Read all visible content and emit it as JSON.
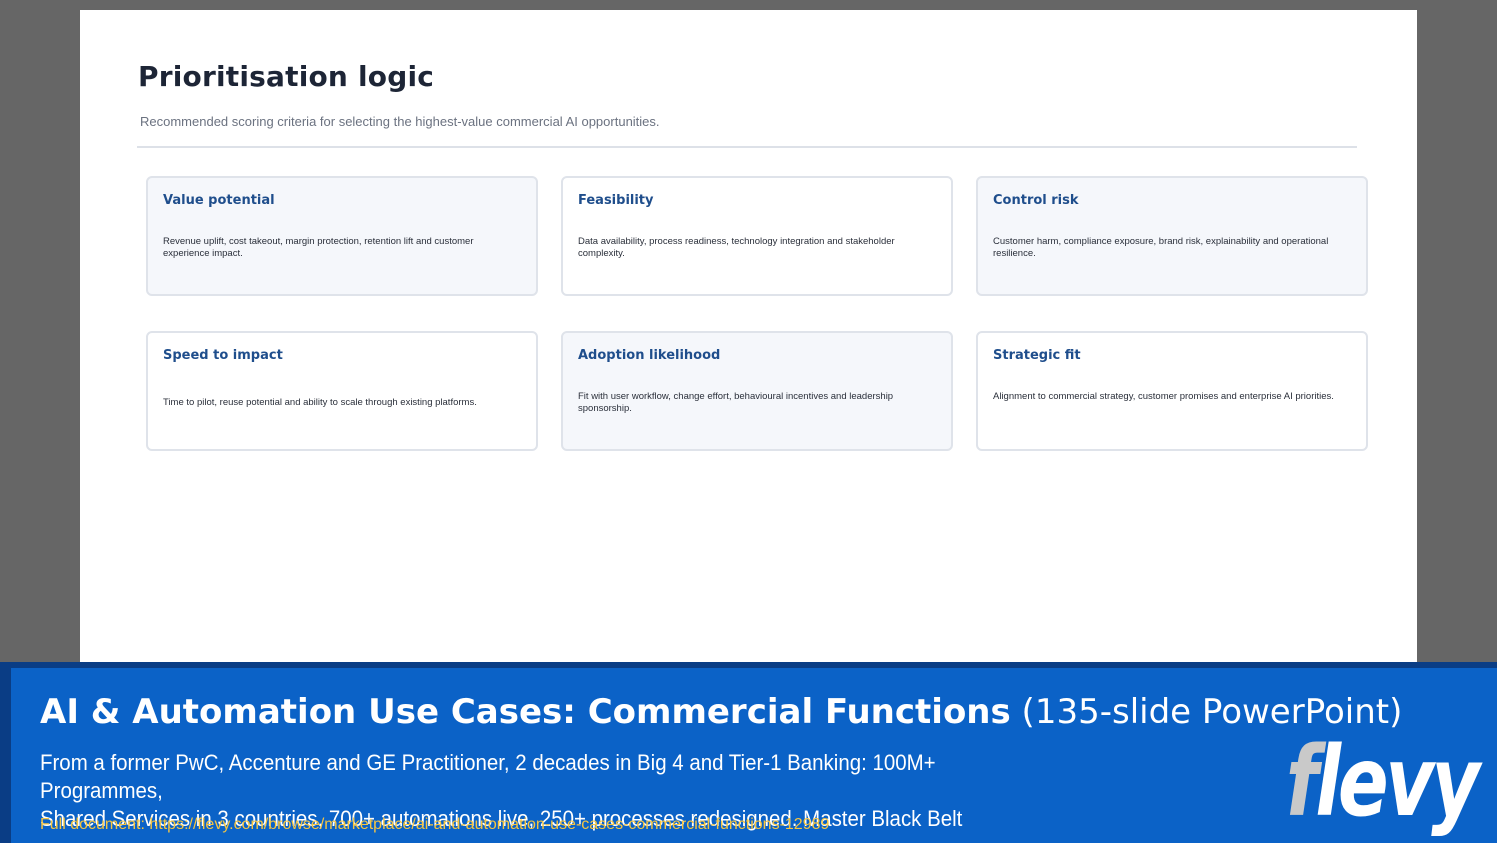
{
  "slide": {
    "title": "Prioritisation logic",
    "subtitle": "Recommended scoring criteria for selecting the highest-value commercial AI opportunities."
  },
  "cards": [
    {
      "title": "Value potential",
      "body": "Revenue uplift, cost takeout, margin protection, retention lift and customer experience impact."
    },
    {
      "title": "Feasibility",
      "body": "Data availability, process readiness, technology integration and stakeholder complexity."
    },
    {
      "title": "Control risk",
      "body": "Customer harm, compliance exposure, brand risk, explainability and operational resilience."
    },
    {
      "title": "Speed to impact",
      "body": "Time to pilot, reuse potential and ability to scale through existing platforms."
    },
    {
      "title": "Adoption likelihood",
      "body": "Fit with user workflow, change effort, behavioural incentives and leadership sponsorship."
    },
    {
      "title": "Strategic fit",
      "body": "Alignment to commercial strategy, customer promises and enterprise AI priorities."
    }
  ],
  "banner": {
    "title_main": "AI & Automation Use Cases: Commercial Functions",
    "title_sub": " (135-slide PowerPoint)",
    "desc_line1": "From a former PwC, Accenture and GE Practitioner, 2 decades in Big 4 and Tier-1 Banking: 100M+ Programmes,",
    "desc_line2": "Shared Services in 3 countries, 700+ automations live, 250+ processes redesigned. Master Black Belt",
    "link_label": "Full document: ",
    "link_url": "https://flevy.com/browse/marketplace/ai-and-automation-use-cases-commercial-functions-12989",
    "logo_f": "f",
    "logo_rest": "levy"
  },
  "colors": {
    "backdrop": "#666666",
    "card_title": "#1f4e8c",
    "banner_blue": "#0b62c7",
    "link_yellow": "#f5c542"
  }
}
